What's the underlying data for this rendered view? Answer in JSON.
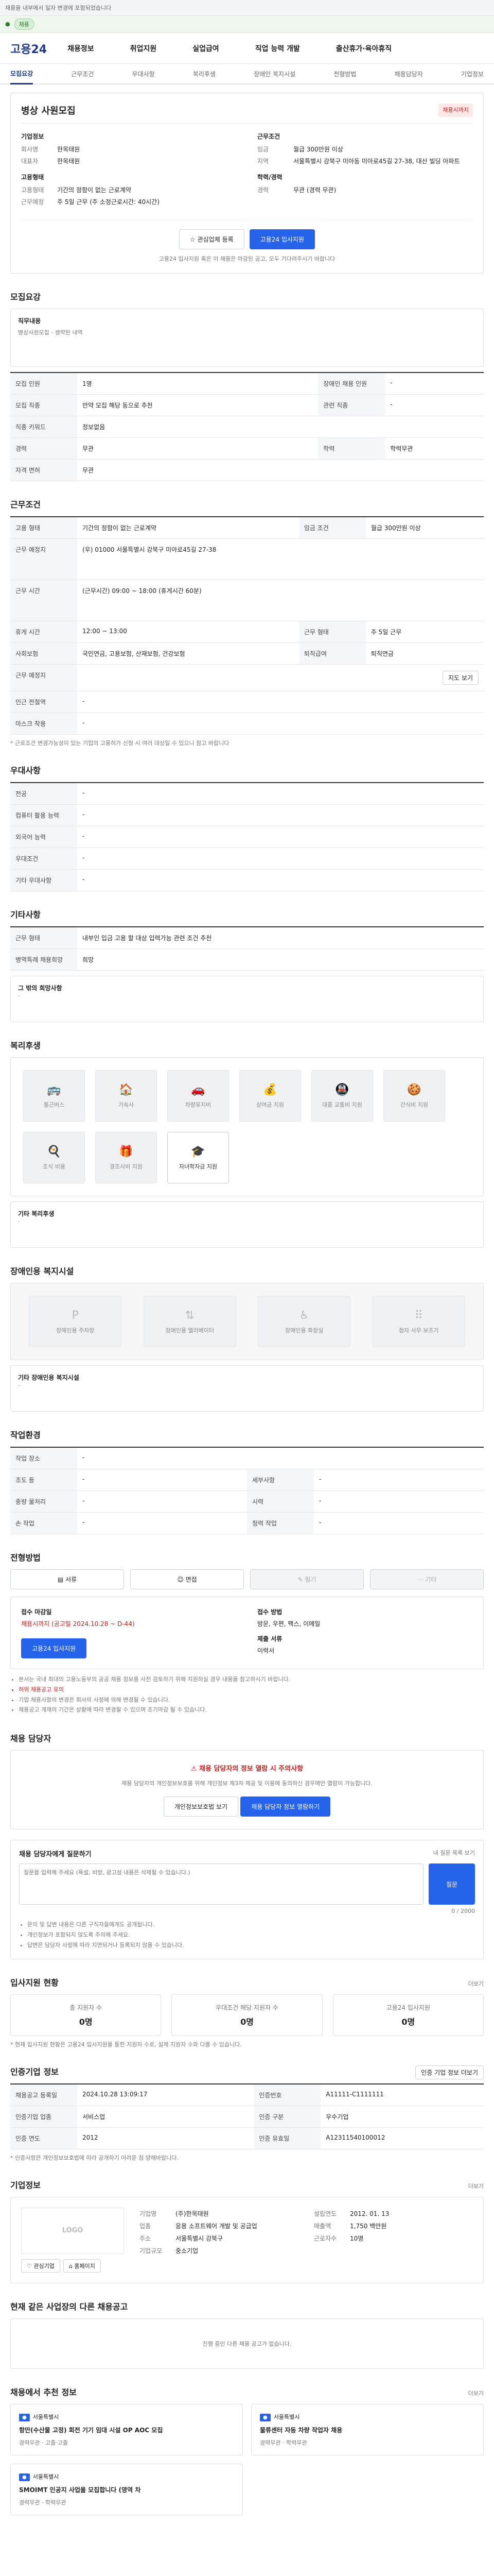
{
  "top": {
    "note": "채용을 내부에서 일자 변경에 포함되었습니다",
    "pill": "채용"
  },
  "header": {
    "logo": "고용24",
    "nav": [
      "채용정보",
      "취업지원",
      "실업급여",
      "직업 능력 개발",
      "출산휴가·육아휴직"
    ]
  },
  "subnav": [
    "모집요강",
    "근무조건",
    "우대사항",
    "복리후생",
    "장애인 복지시설",
    "전형방법",
    "채용담당자",
    "기업정보"
  ],
  "job": {
    "title": "병상 사원모집",
    "status": "채용시까지",
    "company_label": "기업정보",
    "company_name_k": "회사명",
    "company_name": "한목태원",
    "ceo_k": "대표자",
    "ceo": "한목태원",
    "location_label": "근무조건",
    "wage_k": "임금",
    "wage": "월급 300만원 이상",
    "addr_k": "지역",
    "addr": "서울특별시 강북구 미아동 미아로45길 27-38, 대산 빌딩 아파트",
    "employ_label": "고용형태",
    "employ_k": "고용형태",
    "employ": "기간의 정함이 없는 근로계약",
    "hours_k": "근무예정",
    "hours": "주 5일 근무 (주 소정근로시간: 40시간)",
    "career_label": "학력/경력",
    "career_k": "경력",
    "career": "무관 (경력 무관)",
    "btn_scrap": "관심업체 등록",
    "btn_apply": "고용24 입사지원",
    "notice": "고용24 입사지원 혹은 이 채용은 마감된 공고, 모두 기다려주시기 바랍니다"
  },
  "recruit": {
    "title": "모집요강",
    "desc_k": "직무내용",
    "desc": "병상사원모집 - 생략된 내역",
    "rows": [
      [
        "모집 인원",
        "1명",
        "장애인 채용 인원",
        "-"
      ],
      [
        "모집 직종",
        "만약 모집 해당 동으로 추천",
        "관련 직종",
        "-"
      ],
      [
        "직종 키워드",
        "정보없음",
        "",
        ""
      ],
      [
        "경력",
        "무관",
        "학력",
        "학력무관"
      ],
      [
        "자격 면허",
        "무관"
      ]
    ]
  },
  "conditions": {
    "title": "근무조건",
    "rows": [
      [
        "고용 형태",
        "기간의 정함이 없는 근로계약",
        "임금 조건",
        "월급 300만원 이상"
      ],
      [
        "근무 예정지",
        "(우) 01000 서울특별시 강북구 미아로45길 27-38",
        "",
        ""
      ],
      [
        "근무 시간",
        "(근무시간) 09:00 ~ 18:00 (휴게시간 60분)",
        "",
        ""
      ],
      [
        "휴게 시간",
        "12:00 ~ 13:00",
        "근무 형태",
        "주 5일 근무"
      ],
      [
        "사회보험",
        "국민연금, 고용보험, 산재보험, 건강보험",
        "퇴직급여",
        "퇴직연금"
      ],
      [
        "근무 예정지",
        "",
        "",
        ""
      ],
      [
        "인근 전철역",
        "-",
        "",
        ""
      ],
      [
        "마스크 착용",
        "-",
        "",
        ""
      ]
    ],
    "note": "* 근로조건 변경가능성이 있는 기업의 고용허가 신청 시 여러 대상일 수 있으니 참고 바랍니다",
    "map_btn": "지도 보기"
  },
  "prefer": {
    "title": "우대사항",
    "rows": [
      [
        "전공",
        "-"
      ],
      [
        "컴퓨터 활용 능력",
        "-"
      ],
      [
        "외국어 능력",
        "-"
      ],
      [
        "우대조건",
        "-"
      ],
      [
        "기타 우대사항",
        "-"
      ]
    ]
  },
  "other": {
    "title": "기타사항",
    "rows": [
      [
        "근무 형태",
        "내부인 입금 고용 할 대상 입력가능 관련 조건 추천"
      ],
      [
        "병역특례 채용희망",
        "희망"
      ]
    ],
    "sub": "그 밖의 희망사항",
    "sub_val": "-"
  },
  "benefits": {
    "title": "복리후생",
    "items": [
      [
        "통근버스",
        false
      ],
      [
        "기숙사",
        false
      ],
      [
        "차량유지비",
        false
      ],
      [
        "상여금 지원",
        false
      ],
      [
        "대중 교통비 지원",
        false
      ],
      [
        "간식비 지원",
        false
      ],
      [
        "조식 비용",
        false
      ],
      [
        "경조사비 지원",
        false
      ],
      [
        "자녀학자금 지원",
        true
      ]
    ],
    "other_k": "기타 복리후생",
    "other_v": "-"
  },
  "disabled": {
    "title": "장애인용 복지시설",
    "items": [
      "장애인용 주차장",
      "장애인용 엘리베이터",
      "장애인용 화장실",
      "점자 사무 보조기"
    ],
    "other_k": "기타 장애인용 복지시설",
    "other_v": "-"
  },
  "workenv": {
    "title": "작업환경",
    "rows": [
      [
        "작업 장소",
        "-",
        "",
        ""
      ],
      [
        "조도 등",
        "-",
        "세부사항",
        "-"
      ],
      [
        "중량 물처리",
        "-",
        "시력",
        "-"
      ],
      [
        "손 작업",
        "-",
        "청력 작업",
        "-"
      ]
    ]
  },
  "selection": {
    "title": "전형방법",
    "steps": [
      "서류",
      "면접",
      "필기",
      "기타"
    ],
    "apply_k": "접수 마감일",
    "apply_v": "채용시까지 (공고일 2024.10.28 ~ D-44)",
    "method_k": "접수 방법",
    "method_v": "방문, 우편, 팩스, 이메일",
    "docs_k": "제출 서류",
    "docs_v": "이력서",
    "btn": "고용24 입사지원",
    "notes": [
      "본서는 국내 최대의 고용노동부의 공공 채용 정보를 사전 검토하기 위해 지원하실 경우 내용을 참고하시기 바랍니다.",
      "허위 채용공고 유의",
      "기업 채용사항의 변경은 회사의 사정에 의해 변경될 수 있습니다.",
      "채용공고 게재의 기간은 상황에 따라 변경될 수 있으며 조기마감 될 수 있습니다."
    ]
  },
  "contact": {
    "title": "채용 담당자",
    "alert": "채용 담당자의 정보 열람 시 주의사항",
    "alert_body": "채용 담당자의 개인정보보호를 위해 개인정보 제3자 제공 및 이용에 동의하신 경우에만 열람이 가능합니다.",
    "btn1": "개인정보보호법 보기",
    "btn2": "채용 담당자 정보 열람하기"
  },
  "question": {
    "title": "채용 담당자에게 질문하기",
    "link": "내 질문 목록 보기",
    "placeholder": "질문을 입력해 주세요 (욕설, 비방, 광고성 내용은 삭제될 수 있습니다.)",
    "count": "0 / 2000",
    "btn": "질문",
    "notes": [
      "문의 및 답변 내용은 다른 구직자들에게도 공개됩니다.",
      "개인정보가 포함되지 않도록 주의해 주세요.",
      "답변은 담당자 사정에 따라 지연되거나 등록되지 않을 수 있습니다."
    ]
  },
  "status": {
    "title": "입사지원 현황",
    "more": "더보기",
    "cards": [
      [
        "총 지원자 수",
        "0명"
      ],
      [
        "우대조건 해당 지원자 수",
        "0명"
      ],
      [
        "고용24 입사지원",
        "0명"
      ]
    ],
    "note": "* 현재 입사지원 현황은 고용24 입사지원을 통한 지원자 수로, 실제 지원자 수와 다를 수 있습니다."
  },
  "info": {
    "title": "인증기업 정보",
    "more": "인증 기업 정보 더보기",
    "rows": [
      [
        "채용공고 등록일",
        "2024.10.28 13:09:17",
        "인증번호",
        "A11111-C1111111"
      ],
      [
        "인증기업 업종",
        "서비스업",
        "인증 구분",
        "우수기업"
      ],
      [
        "인증 연도",
        "2012",
        "인증 유효일",
        "A12311540100012"
      ]
    ],
    "note": "* 인증사항은 개인정보보호법에 따라 공개하기 어려운 점 양해바랍니다."
  },
  "company": {
    "title": "기업정보",
    "more": "더보기",
    "logo_text": "LOGO",
    "btn_a": "관심기업",
    "btn_b": "홈페이지",
    "kv": [
      [
        "기업명",
        "(주)한목태원"
      ],
      [
        "업종",
        "응용 소프트웨어 개발 및 공급업"
      ],
      [
        "주소",
        "서울특별시 강북구"
      ],
      [
        "기업규모",
        "중소기업"
      ]
    ],
    "kv2": [
      [
        "설립연도",
        "2012. 01. 13"
      ],
      [
        "매출액",
        "1,750 백만원"
      ],
      [
        "근로자수",
        "10명"
      ]
    ]
  },
  "others": {
    "title": "현재 같은 사업장의 다른 채용공고",
    "empty": "진행 중인 다른 채용 공고가 없습니다."
  },
  "recommend": {
    "title": "채용에서 추천 정보",
    "more": "더보기",
    "items": [
      [
        "서울특별시",
        "항만(수산물 고정) 회전 기기 임대 시설 OP AOC 모집",
        "경력무관",
        "고졸·고졸"
      ],
      [
        "서울특별시",
        "물류센터 자동 차량 작업자 채용",
        "경력무관",
        "학력무관"
      ],
      [
        "서울특별시",
        "SMOIMT 인공지 사업을 모집합니다 (영역 차",
        "경력무관",
        "학력무관"
      ],
      [
        "",
        "",
        "",
        ""
      ]
    ]
  }
}
